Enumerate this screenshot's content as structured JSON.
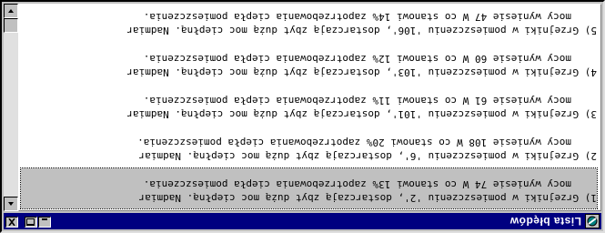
{
  "window": {
    "title": "Lista błędów"
  },
  "icons": {
    "app": "app-icon",
    "minimize": "minimize-icon",
    "maximize": "maximize-icon",
    "close": "close-icon",
    "scroll_up": "arrow-up-icon",
    "scroll_down": "arrow-down-icon"
  },
  "colors": {
    "titlebar": "#000080",
    "face": "#c0c0c0",
    "list_bg": "#ffffff"
  },
  "list": {
    "selected_index": 0,
    "items": [
      {
        "line1": "1) Grzejniki w pomieszczeniu '2', dostarczają zbyt dużą moc ciepłną. Nadmiar",
        "line2": "mocy wyniesie 74 W co stanowi 13% zapotrzebowania ciepła pomieszczenia."
      },
      {
        "line1": "2) Grzejniki w pomieszczeniu '6', dostarczają zbyt dużą moc ciepłną. Nadmiar",
        "line2": "mocy wyniesie 108 W co stanowi 20% zapotrzebowania ciepła pomieszczenia."
      },
      {
        "line1": "3) Grzejniki w pomieszczeniu '101', dostarczają zbyt dużą moc ciepłną. Nadmiar",
        "line2": "mocy wyniesie 61 W co stanowi 11% zapotrzebowania ciepła pomieszczenia."
      },
      {
        "line1": "4) Grzejniki w pomieszczeniu '103', dostarczają zbyt dużą moc ciepłną. Nadmiar",
        "line2": "mocy wyniesie 60 W co stanowi 12% zapotrzebowania ciepła pomieszczenia."
      },
      {
        "line1": "5) Grzejniki w pomieszczeniu '106', dostarczają zbyt dużą moc ciepłną. Nadmiar",
        "line2": "mocy wyniesie 47 W co stanowi 14% zapotrzebowania ciepła pomieszczenia."
      }
    ]
  }
}
